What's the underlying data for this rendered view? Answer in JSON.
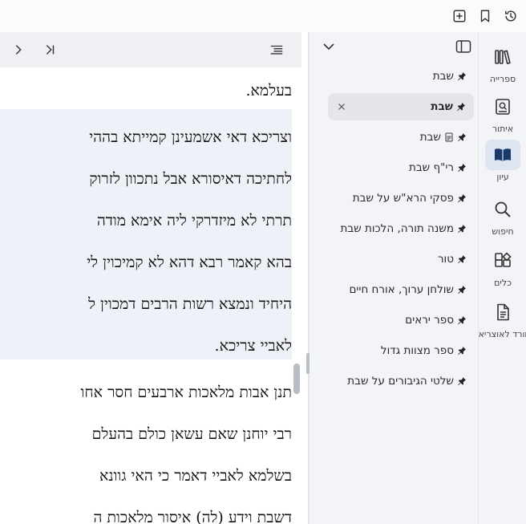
{
  "topbar": {
    "icons": [
      "history-icon",
      "bookmark-icon",
      "add-tab-icon"
    ]
  },
  "reader": {
    "toolbar_icons": [
      "last-page-icon",
      "next-icon",
      "toc-icon"
    ],
    "lines": [
      "בעלמא.",
      "וצריכא דאי אשמעינן קמייתא בההי",
      "לחתיכה דאיסורא אבל נתכוון לזרוק",
      "תרתי לא מיזדרקי ליה אימא מודה",
      "בהא קאמר רבא דהא לא קמיכוין לי",
      "היחיד ונמצא רשות הרבים דמכוין ל",
      "לאביי צריכא.",
      "תנן אבות מלאכות ארבעים חסר אחו",
      "רבי יוחנן שאם עשאן כולם בהעלם",
      "בשלמא לאביי דאמר כי האי גוונא",
      "דשבת וידע (לה) איסור מלאכות ה"
    ]
  },
  "panel": {
    "books": [
      {
        "label": "שבת",
        "active": false,
        "extra_icon": false
      },
      {
        "label": "שבת",
        "active": true,
        "extra_icon": false
      },
      {
        "label": "שבת",
        "active": false,
        "extra_icon": true
      },
      {
        "label": "רי\"ף שבת",
        "active": false,
        "extra_icon": false
      },
      {
        "label": "פסקי הרא\"ש על שבת",
        "active": false,
        "extra_icon": false
      },
      {
        "label": "משנה תורה, הלכות שבת",
        "active": false,
        "extra_icon": false
      },
      {
        "label": "טור",
        "active": false,
        "extra_icon": false
      },
      {
        "label": "שולחן ערוך, אורח חיים",
        "active": false,
        "extra_icon": false
      },
      {
        "label": "ספר יראים",
        "active": false,
        "extra_icon": false
      },
      {
        "label": "ספר מצוות גדול",
        "active": false,
        "extra_icon": false
      },
      {
        "label": "שלטי הגיבורים על שבת",
        "active": false,
        "extra_icon": false
      }
    ]
  },
  "rail": {
    "items": [
      {
        "label": "ספרייה",
        "icon": "library-icon",
        "active": false
      },
      {
        "label": "איתור",
        "icon": "find-ref-icon",
        "active": false
      },
      {
        "label": "עיון",
        "icon": "reading-book-icon",
        "active": true
      },
      {
        "label": "חיפוש",
        "icon": "search-icon",
        "active": false
      },
      {
        "label": "כלים",
        "icon": "tools-icon",
        "active": false
      },
      {
        "label": "וורד לאוצריא",
        "icon": "word-document-icon",
        "active": false
      }
    ]
  },
  "colors": {
    "accent": "#1a3a6b",
    "active_rail_bg": "#dde5f3",
    "highlight_bg": "#eef1f7",
    "panel_bg": "#f3f4f7"
  }
}
